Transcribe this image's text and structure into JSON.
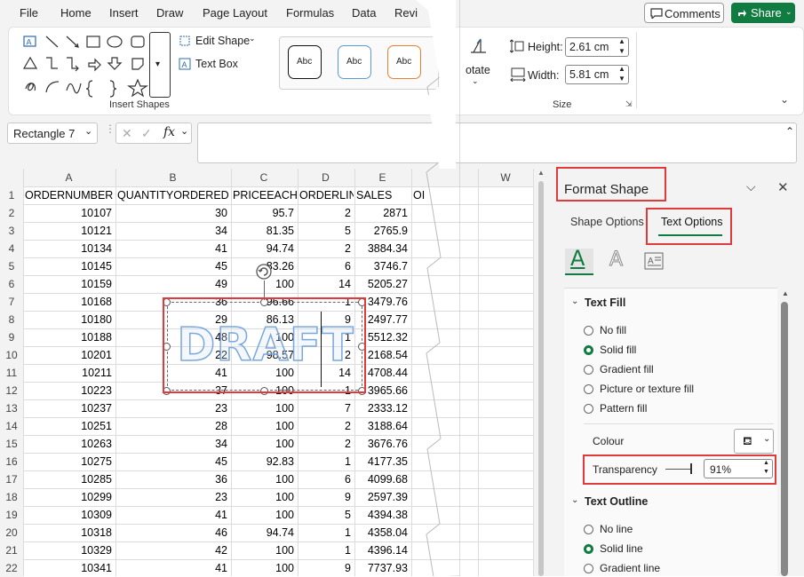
{
  "menu": {
    "tabs": [
      "File",
      "Home",
      "Insert",
      "Draw",
      "Page Layout",
      "Formulas",
      "Data",
      "Revi"
    ],
    "comments": "Comments",
    "share": "Share"
  },
  "ribbon": {
    "edit_shape": "Edit Shape",
    "text_box": "Text Box",
    "insert_shapes": "Insert Shapes",
    "style_sample": "Abc",
    "rotate": "otate",
    "height_label": "Height:",
    "height_value": "2.61 cm",
    "width_label": "Width:",
    "width_value": "5.81 cm",
    "size_label": "Size"
  },
  "formula_bar": {
    "name_box": "Rectangle 7",
    "fx": "fx"
  },
  "sheet": {
    "columns": [
      "A",
      "B",
      "C",
      "D",
      "E",
      "W"
    ],
    "headers": [
      "ORDERNUMBER",
      "QUANTITYORDERED",
      "PRICEEACH",
      "ORDERLIN",
      "SALES",
      "OI"
    ],
    "rows": [
      [
        "2",
        "10107",
        "30",
        "95.7",
        "2",
        "2871"
      ],
      [
        "3",
        "10121",
        "34",
        "81.35",
        "5",
        "2765.9"
      ],
      [
        "4",
        "10134",
        "41",
        "94.74",
        "2",
        "3884.34"
      ],
      [
        "5",
        "10145",
        "45",
        "83.26",
        "6",
        "3746.7"
      ],
      [
        "6",
        "10159",
        "49",
        "100",
        "14",
        "5205.27"
      ],
      [
        "7",
        "10168",
        "36",
        "96.66",
        "1",
        "3479.76"
      ],
      [
        "8",
        "10180",
        "29",
        "86.13",
        "9",
        "2497.77"
      ],
      [
        "9",
        "10188",
        "48",
        "100",
        "1",
        "5512.32"
      ],
      [
        "10",
        "10201",
        "22",
        "98.57",
        "2",
        "2168.54"
      ],
      [
        "11",
        "10211",
        "41",
        "100",
        "14",
        "4708.44"
      ],
      [
        "12",
        "10223",
        "37",
        "100",
        "1",
        "3965.66"
      ],
      [
        "13",
        "10237",
        "23",
        "100",
        "7",
        "2333.12"
      ],
      [
        "14",
        "10251",
        "28",
        "100",
        "2",
        "3188.64"
      ],
      [
        "15",
        "10263",
        "34",
        "100",
        "2",
        "3676.76"
      ],
      [
        "16",
        "10275",
        "45",
        "92.83",
        "1",
        "4177.35"
      ],
      [
        "17",
        "10285",
        "36",
        "100",
        "6",
        "4099.68"
      ],
      [
        "18",
        "10299",
        "23",
        "100",
        "9",
        "2597.39"
      ],
      [
        "19",
        "10309",
        "41",
        "100",
        "5",
        "4394.38"
      ],
      [
        "20",
        "10318",
        "46",
        "94.74",
        "1",
        "4358.04"
      ],
      [
        "21",
        "10329",
        "42",
        "100",
        "1",
        "4396.14"
      ],
      [
        "22",
        "10341",
        "41",
        "100",
        "9",
        "7737.93"
      ]
    ],
    "watermark": "DRAFT"
  },
  "pane": {
    "title": "Format Shape",
    "tab_shape": "Shape Options",
    "tab_text": "Text Options",
    "text_fill": "Text Fill",
    "fill_options": [
      "No fill",
      "Solid fill",
      "Gradient fill",
      "Picture or texture fill",
      "Pattern fill"
    ],
    "colour": "Colour",
    "transparency": "Transparency",
    "transparency_value": "91%",
    "text_outline": "Text Outline",
    "outline_options": [
      "No line",
      "Solid line",
      "Gradient line"
    ]
  },
  "colors": {
    "accent": "#107c41",
    "highlight": "#e03a3a"
  }
}
